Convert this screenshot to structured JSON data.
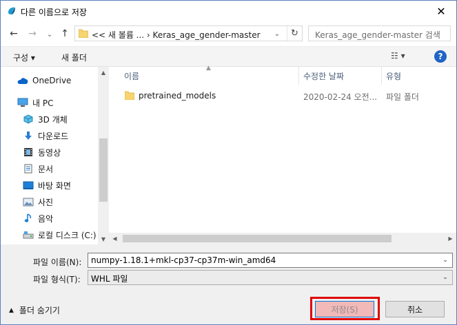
{
  "window": {
    "title": "다른 이름으로 저장",
    "close_glyph": "✕"
  },
  "nav": {
    "back_glyph": "←",
    "forward_glyph": "→",
    "recent_glyph": "⌄",
    "up_glyph": "↑",
    "address": "<< 새 볼륨 ...  ›  Keras_age_gender-master",
    "address_chevron": "⌄",
    "refresh_glyph": "↻",
    "search_placeholder": "Keras_age_gender-master 검색"
  },
  "toolbar": {
    "organize_label": "구성 ▾",
    "new_folder_label": "새 폴더",
    "view_glyph": "☷ ▾",
    "help_glyph": "?"
  },
  "sidebar": {
    "items": [
      {
        "label": "OneDrive",
        "icon": "cloud-icon"
      },
      {
        "label": "내 PC",
        "icon": "computer-icon"
      },
      {
        "label": "3D 개체",
        "icon": "cube-icon"
      },
      {
        "label": "다운로드",
        "icon": "download-icon"
      },
      {
        "label": "동영상",
        "icon": "film-icon"
      },
      {
        "label": "문서",
        "icon": "document-icon"
      },
      {
        "label": "바탕 화면",
        "icon": "desktop-icon"
      },
      {
        "label": "사진",
        "icon": "pictures-icon"
      },
      {
        "label": "음악",
        "icon": "music-icon"
      },
      {
        "label": "로컬 디스크 (C:)",
        "icon": "drive-icon"
      }
    ]
  },
  "columns": {
    "name": "이름",
    "modified": "수정한 날짜",
    "type": "유형"
  },
  "files": [
    {
      "name": "pretrained_models",
      "modified": "2020-02-24 오전...",
      "type": "파일 폴더"
    }
  ],
  "form": {
    "filename_label": "파일 이름(N):",
    "filename_value": "numpy-1.18.1+mkl-cp37-cp37m-win_amd64",
    "filetype_label": "파일 형식(T):",
    "filetype_value": "WHL 파일"
  },
  "footer": {
    "hide_folders_label": "폴더 숨기기",
    "save_label": "저장(S)",
    "cancel_label": "취소"
  },
  "colors": {
    "accent": "#0078d7",
    "highlight": "#e00000",
    "folder": "#f7d470",
    "help": "#1f64c6"
  }
}
